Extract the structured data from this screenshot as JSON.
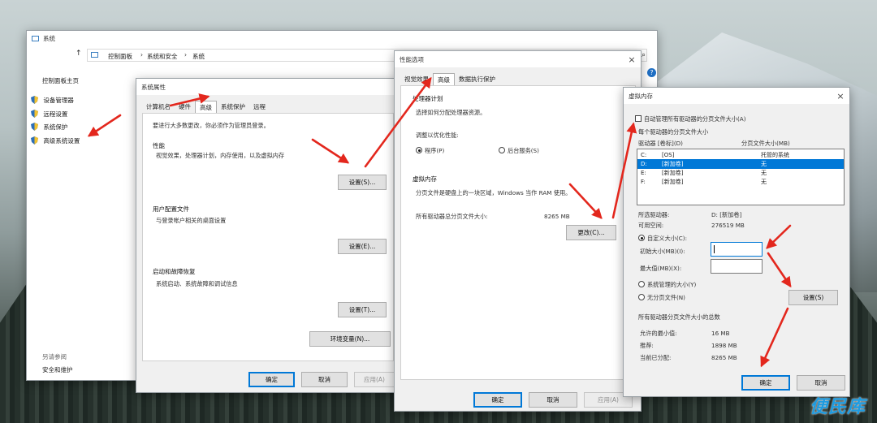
{
  "system_window": {
    "title": "系统",
    "breadcrumb": [
      "控制面板",
      "系统和安全",
      "系统"
    ],
    "sidebar_home": "控制面板主页",
    "sidebar_items": [
      "设备管理器",
      "远程设置",
      "系统保护",
      "高级系统设置"
    ],
    "see_also_title": "另请参阅",
    "see_also_item": "安全和维护"
  },
  "sysprops": {
    "title": "系统属性",
    "tabs": [
      "计算机名",
      "硬件",
      "高级",
      "系统保护",
      "远程"
    ],
    "active_tab": "高级",
    "admin_note": "要进行大多数更改，你必须作为管理员登录。",
    "performance": {
      "title": "性能",
      "desc": "视觉效果，处理器计划，内存使用，以及虚拟内存",
      "button": "设置(S)..."
    },
    "profiles": {
      "title": "用户配置文件",
      "desc": "与登录帐户相关的桌面设置",
      "button": "设置(E)..."
    },
    "startup": {
      "title": "启动和故障恢复",
      "desc": "系统启动、系统故障和调试信息",
      "button": "设置(T)..."
    },
    "env_button": "环境变量(N)...",
    "ok": "确定",
    "cancel": "取消",
    "apply": "应用(A)"
  },
  "perf": {
    "title": "性能选项",
    "tabs": [
      "视觉效果",
      "高级",
      "数据执行保护"
    ],
    "active_tab": "高级",
    "sched_title": "处理器计划",
    "sched_desc": "选择如何分配处理器资源。",
    "adjust_label": "调整以优化性能:",
    "radio_programs": "程序(P)",
    "radio_services": "后台服务(S)",
    "vm_title": "虚拟内存",
    "vm_desc": "分页文件是硬盘上的一块区域，Windows 当作 RAM 使用。",
    "total_label": "所有驱动器总分页文件大小:",
    "total_value": "8265 MB",
    "change_button": "更改(C)...",
    "ok": "确定",
    "cancel": "取消",
    "apply": "应用(A)"
  },
  "vm": {
    "title": "虚拟内存",
    "auto_manage": "自动管理所有驱动器的分页文件大小(A)",
    "per_drive_label": "每个驱动器的分页文件大小",
    "col_drive": "驱动器 [卷标](D)",
    "col_size": "分页文件大小(MB)",
    "rows": [
      {
        "drive": "C:",
        "label": "[OS]",
        "size": "托管的系统"
      },
      {
        "drive": "D:",
        "label": "[新加卷]",
        "size": "无"
      },
      {
        "drive": "E:",
        "label": "[新加卷]",
        "size": "无"
      },
      {
        "drive": "F:",
        "label": "[新加卷]",
        "size": "无"
      }
    ],
    "selected_drive_label": "所选驱动器:",
    "selected_drive_value": "D:  [新加卷]",
    "free_label": "可用空间:",
    "free_value": "276519 MB",
    "custom_size": "自定义大小(C):",
    "initial_label": "初始大小(MB)(I):",
    "max_label": "最大值(MB)(X):",
    "initial_value": "",
    "max_value": "",
    "system_managed": "系统管理的大小(Y)",
    "no_paging": "无分页文件(N)",
    "set_button": "设置(S)",
    "totals_title": "所有驱动器分页文件大小的总数",
    "min_label": "允许的最小值:",
    "min_value": "16 MB",
    "rec_label": "推荐:",
    "rec_value": "1898 MB",
    "cur_label": "当前已分配:",
    "cur_value": "8265 MB",
    "ok": "确定",
    "cancel": "取消"
  },
  "watermark": "便民库",
  "colors": {
    "accent": "#0078d7",
    "arrow": "#e3271d",
    "watermark": "#1e9be0"
  }
}
